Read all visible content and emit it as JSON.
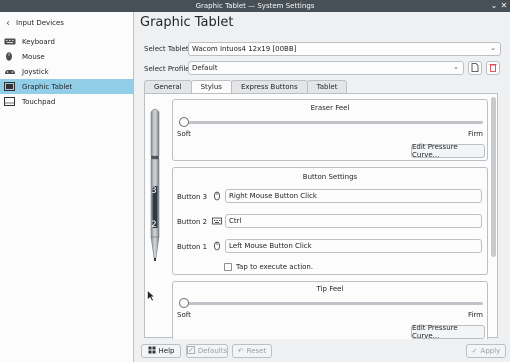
{
  "window": {
    "title": "Graphic Tablet — System Settings"
  },
  "sidebar": {
    "header": "Input Devices",
    "items": [
      {
        "label": "Keyboard",
        "icon": "keyboard-icon"
      },
      {
        "label": "Mouse",
        "icon": "mouse-icon"
      },
      {
        "label": "Joystick",
        "icon": "joystick-icon"
      },
      {
        "label": "Graphic Tablet",
        "icon": "tablet-icon",
        "active": true
      },
      {
        "label": "Touchpad",
        "icon": "touchpad-icon"
      }
    ]
  },
  "main": {
    "title": "Graphic Tablet",
    "select_tablet_label": "Select Tablet:",
    "select_tablet_value": "Wacom Intuos4 12x19 [00BB]",
    "select_profile_label": "Select Profile:",
    "select_profile_value": "Default",
    "tabs": [
      "General",
      "Stylus",
      "Express Buttons",
      "Tablet"
    ],
    "active_tab": "Stylus"
  },
  "stylus": {
    "button_numbers": [
      "3",
      "2"
    ],
    "eraser_feel": {
      "title": "Eraser Feel",
      "min_label": "Soft",
      "max_label": "Firm",
      "value": 0.0,
      "edit_button": "Edit Pressure Curve..."
    },
    "button_settings": {
      "title": "Button Settings",
      "rows": [
        {
          "label": "Button 3",
          "icon": "mouse-icon",
          "value": "Right Mouse Button Click"
        },
        {
          "label": "Button 2",
          "icon": "keyboard-icon",
          "value": "Ctrl"
        },
        {
          "label": "Button 1",
          "icon": "mouse-icon",
          "value": "Left Mouse Button Click"
        }
      ],
      "tap_label": "Tap to execute action."
    },
    "tip_feel": {
      "title": "Tip Feel",
      "min_label": "Soft",
      "max_label": "Firm",
      "value": 0.0,
      "edit_button": "Edit Pressure Curve..."
    }
  },
  "footer": {
    "help": "Help",
    "defaults": "Defaults",
    "reset": "Reset",
    "apply": "Apply"
  }
}
